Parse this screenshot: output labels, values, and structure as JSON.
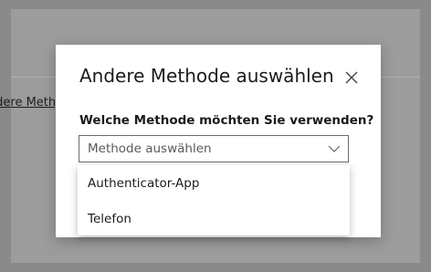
{
  "background": {
    "link_text": "Andere Methode"
  },
  "dialog": {
    "title": "Andere Methode auswählen",
    "close_icon": "close-icon",
    "question": "Welche Methode möchten Sie verwenden?",
    "select": {
      "placeholder": "Methode auswählen",
      "chevron_icon": "chevron-down-icon"
    },
    "options": [
      {
        "label": "Authenticator-App"
      },
      {
        "label": "Telefon"
      }
    ]
  }
}
